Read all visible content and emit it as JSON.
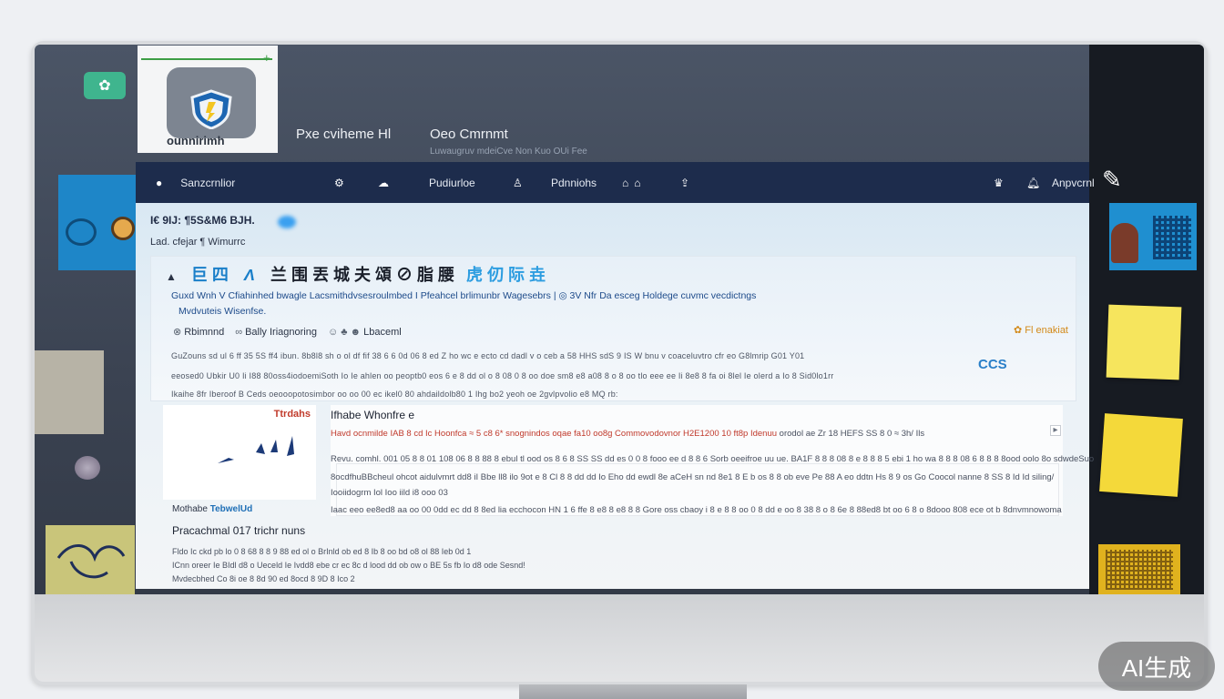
{
  "desktop": {
    "left_icon": "app-icon",
    "watermark": "AI生成"
  },
  "app": {
    "logo_text": "ounnirimh",
    "title": "Pxe cviheme Hl",
    "title2": "Oeo Cmrnmt",
    "subtitle": "Luwaugruv mdeiCve Non Kuo OUi Fee"
  },
  "nav": {
    "items": [
      {
        "label": "Sanzcrnlior",
        "icon": "dot-icon"
      },
      {
        "label": "",
        "icon": "settings-icon"
      },
      {
        "label": "",
        "icon": "cloud-icon"
      },
      {
        "label": "Pudiurloe",
        "icon": ""
      },
      {
        "label": "",
        "icon": "user-icon"
      },
      {
        "label": "Pdnniohs",
        "icon": ""
      },
      {
        "label": "",
        "icon": "home-icon"
      },
      {
        "label": "",
        "icon": "upload-icon"
      }
    ],
    "right_icons": [
      "crown-icon",
      "bell-icon"
    ],
    "account_label": "Anpvcrnl"
  },
  "content": {
    "breadcrumb": "I€ 9IJ: ¶5S&M6 BJH.",
    "sub_breadcrumb": "Lad. cfejar   ¶ Wimurrc",
    "card": {
      "title_a": "巨 四",
      "title_b": "Λ",
      "title_c": "兰 围 丟 城 夫 頌 ⊘ 脂 腰",
      "title_d": "虎 仞 际 垚",
      "desc1": "Guxd Wnh V Cfiahinhed bwagle   Lacsmithdvsesroulmbed I Pfeahcel brlimunbr Wagesebrs | ◎   3V Nfr Da esceg Holdege cuvmc vecdictngs",
      "desc2": "Mvdvuteis Wisenfse.",
      "chips": [
        "Rbimnnd",
        "Bally Iriagnoring",
        "Lbaceml"
      ],
      "badge": "Fl enakiat",
      "para1": "GuZouns sd ul 6 ff 35 5S ff4 ibun. 8b8l8 sh o ol df fif 38 6 6 0d 06 8 ed Z ho wc e   ecto cd dadl v   o ceb   a 58 HHS sdS 9 IS W bnu v coaceluvtro cfr eo   G8lmrip   G01 Y01",
      "para2": "eeosed0 Ubkir U0 Ii I88 80oss4iodoemiSoth Io Ie ahlen oo peoptb0 eos 6 e   8 dd ol o 8 08 0 8 oo doe sm8 e8 a08 8 o 8 oo tlo eee ee Ii 8e8 8 fa oi 8lel Ie olerd a Io 8 Sid0lo1rr",
      "para3": "Ikaihe   8fr Iberoof B Ceds oeooopotosimbor oo oo 00 ec ikel0 80 ahdaildolb80 1 Ihg bo2 yeoh oe 2gvlpvolio e8 MQ rb:",
      "mark": "CCS"
    },
    "thumb": {
      "red_label": "Ttrdahs",
      "caption_a": "Mothabe",
      "caption_b": "TebwelUd",
      "project": "Pracachmal 017 trichr nuns",
      "small1": "Fldo Ic ckd pb lo 0 8 68 8 8 9 88 ed ol o BrInld ob ed 8 Ib 8 oo bd o8 ol 88 Ieb 0d 1",
      "small2": "ICnn oreer Ie BIdl d8 o Ueceld Ie Ivdd8 ebe cr ec 8c d lood dd ob ow o BE 5s fb Io d8 ode Sesnd!",
      "small3": "Mvdecbhed Co 8i oe 8 8d 90 ed 8ocd 8 9D 8 Ico 2"
    },
    "detail": {
      "title": "Ifhabe Whonfre e",
      "hl_prefix": "Havd ocnmilde   IAB 8 cd Ic Hoonfca ≈ 5 c8 6* snognindos oqae fa10   oo8g Commovodovnor H2E1200 10 ft8p Idenuu",
      "hl_suffix": "orodol ae Zr 18 HEFS SS 8 0 ≈ 3h/ Ils",
      "line1": "Revu. comhl. 001 05 8 8 01 108 06 8 8 88 8 ebul tl ood os 8 6 8 SS SS dd es 0 0 8 fooo ee d 8 8 6   Sorb oeeifroe   uu ue. BA1F 8 8 8 08 8 e 8 8 8 5 ebi 1 ho wa 8 8 8 08 6 8 8 8 8ood oolo   8o sdwdeSuo",
      "line2": "8ocdfhuBBcheul ohcot aidulvmrt dd8 iI Bbe ll8 ilo 9ot e 8 Cl 8 8 dd dd Io Eho   dd ewdl 8e   aCeH sn nd 8e1 8 E b os 8 8 ob eve Pe 88 A eo ddtn Hs 8 9 os Go Coocol nanne 8 SS 8 Id Id siling/",
      "line3": "Iooiidogrm Iol Ioo iild i8 ooo 03",
      "line4": "Iaac eeo ee8ed8 aa oo 00 0dd ec dd 8 8ed lia ecchocon   HN 1 6 ffe 8 e8 8 e8 8 8 Gore oss cbaoy i 8 e 8 8 oo 0 8 dd e oo 8 38 8 o 8 6e 8 88ed8 bt oo 6 8 o 8dooo 808 ece ot b 8dnvmnowoma"
    }
  }
}
